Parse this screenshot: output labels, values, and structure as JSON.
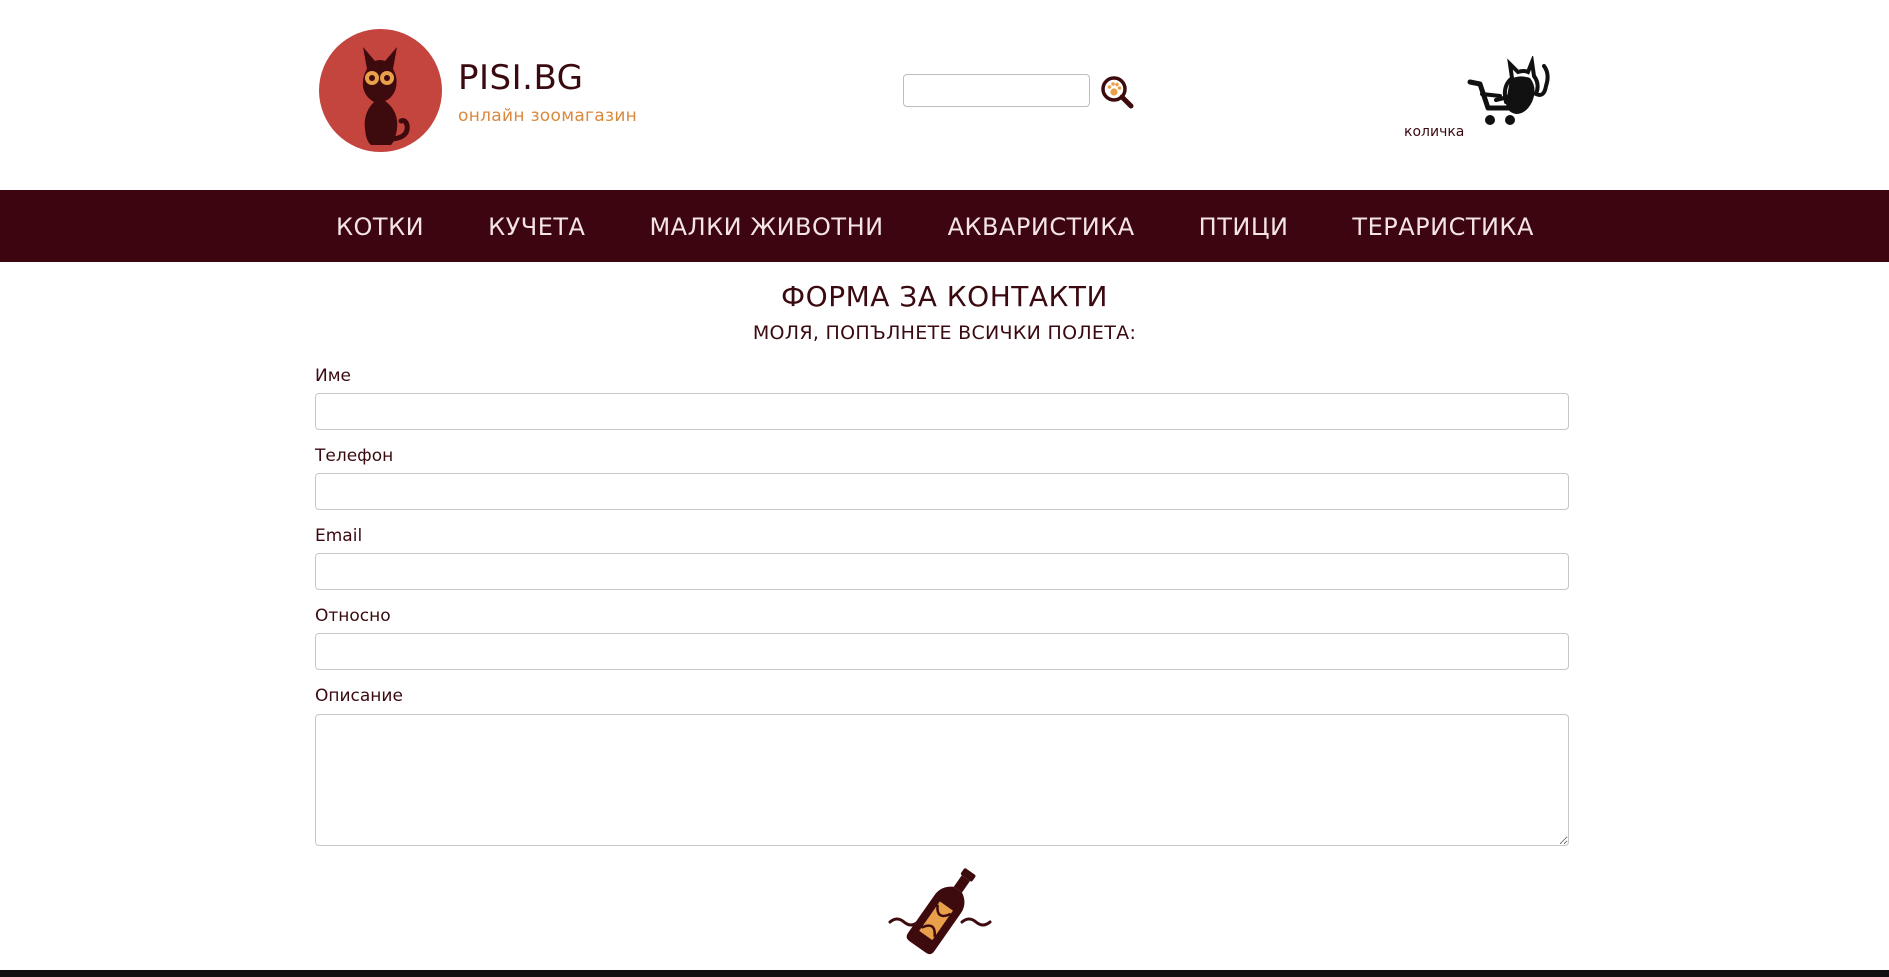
{
  "header": {
    "brand_title": "PISI.BG",
    "brand_subtitle": "онлайн зоомагазин",
    "search": {
      "value": "",
      "placeholder": ""
    },
    "cart_label": "количка"
  },
  "nav": {
    "items": [
      {
        "label": "КОТКИ"
      },
      {
        "label": "КУЧЕТА"
      },
      {
        "label": "МАЛКИ ЖИВОТНИ"
      },
      {
        "label": "АКВАРИСТИКА"
      },
      {
        "label": "ПТИЦИ"
      },
      {
        "label": "ТЕРАРИСТИКА"
      }
    ]
  },
  "form": {
    "title": "ФОРМА ЗА КОНТАКТИ",
    "subtitle": "МОЛЯ, ПОПЪЛНЕТЕ ВСИЧКИ ПОЛЕТА:",
    "fields": [
      {
        "label": "Име",
        "value": ""
      },
      {
        "label": "Телефон",
        "value": ""
      },
      {
        "label": "Email",
        "value": ""
      },
      {
        "label": "Относно",
        "value": ""
      },
      {
        "label": "Описание",
        "value": ""
      }
    ]
  },
  "icons": {
    "logo": "cat-logo-icon",
    "search": "paw-magnifier-icon",
    "cart": "cat-shopping-cart-icon",
    "submit": "message-in-bottle-icon"
  },
  "colors": {
    "brand_dark": "#3d0510",
    "logo_red": "#c4443e",
    "accent_orange": "#d9893d"
  }
}
